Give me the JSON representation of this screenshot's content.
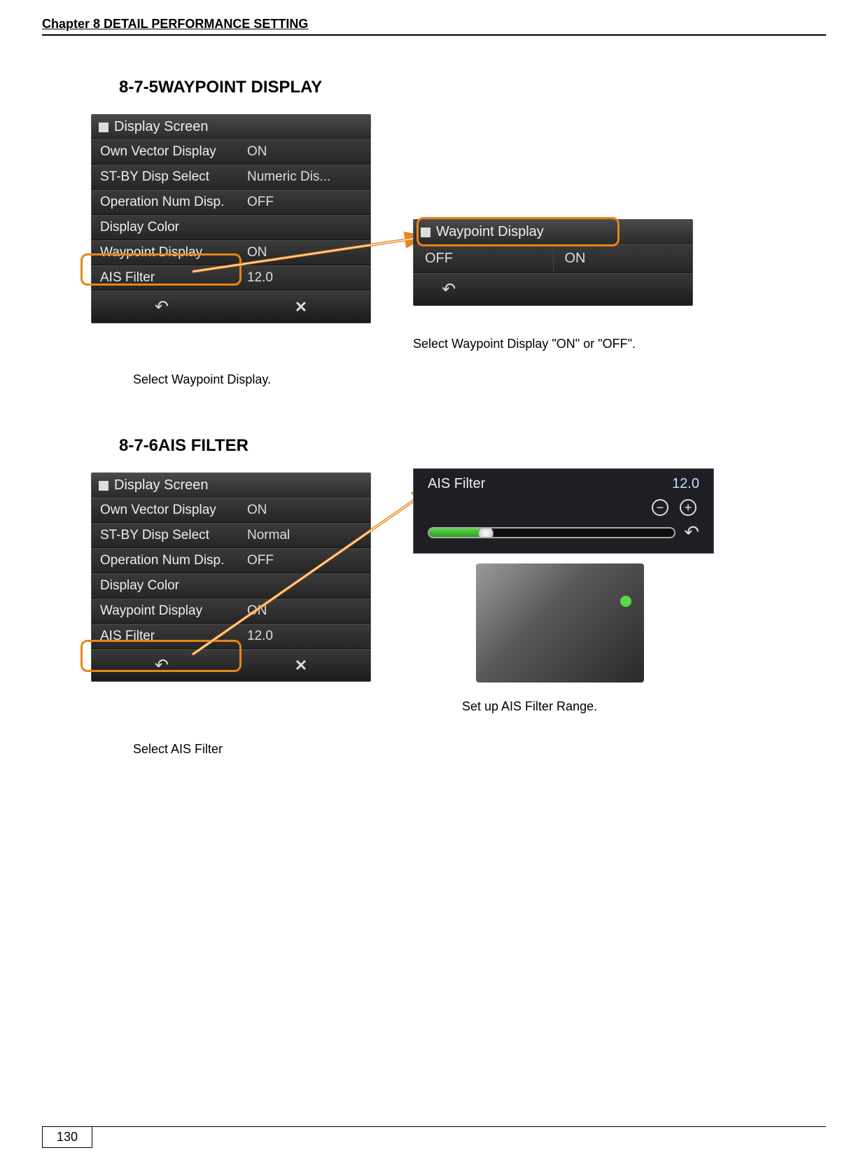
{
  "header": "Chapter 8  DETAIL PERFORMANCE SETTING",
  "section1": {
    "title": "8-7-5WAYPOINT DISPLAY",
    "screenA": {
      "title": "Display Screen",
      "rows": [
        {
          "label": "Own Vector Display",
          "value": "ON"
        },
        {
          "label": "ST-BY Disp Select",
          "value": "Numeric Dis..."
        },
        {
          "label": "Operation Num Disp.",
          "value": "OFF"
        },
        {
          "label": "Display Color",
          "value": ""
        },
        {
          "label": "Waypoint Display",
          "value": "ON"
        },
        {
          "label": "AIS Filter",
          "value": "12.0"
        }
      ]
    },
    "screenB": {
      "title": "Waypoint Display",
      "options": {
        "off": "OFF",
        "on": "ON"
      }
    },
    "captionA": "Select Waypoint Display.",
    "captionB": "Select Waypoint Display \"ON\" or \"OFF\"."
  },
  "section2": {
    "title": "8-7-6AIS FILTER",
    "screenA": {
      "title": "Display Screen",
      "rows": [
        {
          "label": "Own Vector Display",
          "value": "ON"
        },
        {
          "label": "ST-BY Disp Select",
          "value": "Normal"
        },
        {
          "label": "Operation Num Disp.",
          "value": "OFF"
        },
        {
          "label": "Display Color",
          "value": ""
        },
        {
          "label": "Waypoint Display",
          "value": "ON"
        },
        {
          "label": "AIS Filter",
          "value": "12.0"
        }
      ]
    },
    "slider": {
      "title": "AIS Filter",
      "value": "12.0"
    },
    "captionA": "Select AIS Filter",
    "captionB": "Set up AIS Filter Range."
  },
  "pageNumber": "130"
}
